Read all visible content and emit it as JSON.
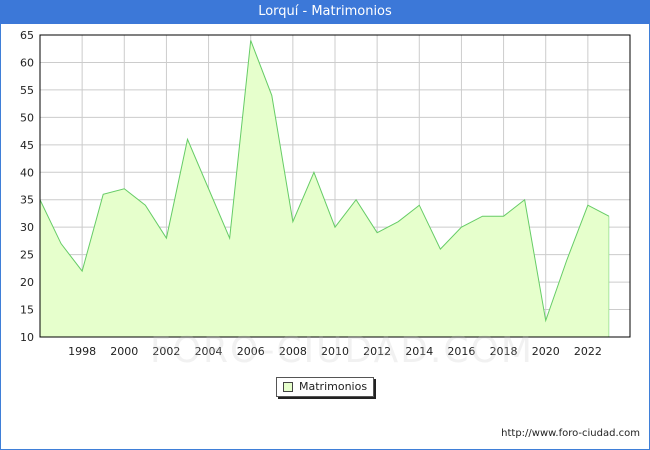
{
  "page": {
    "title": "Lorquí - Matrimonios",
    "source": "http://www.foro-ciudad.com",
    "watermark": "FORO-CIUDAD.COM"
  },
  "colors": {
    "titlebar": "#3c78d8",
    "area_fill": "#e6ffcc",
    "line": "#66cc66",
    "grid": "#cccccc"
  },
  "chart_data": {
    "type": "area",
    "title": "Lorquí - Matrimonios",
    "xlabel": "",
    "ylabel": "",
    "xlim": [
      1996,
      2024
    ],
    "ylim": [
      10,
      65
    ],
    "x_ticks": [
      1998,
      2000,
      2002,
      2004,
      2006,
      2008,
      2010,
      2012,
      2014,
      2016,
      2018,
      2020,
      2022
    ],
    "y_ticks": [
      10,
      15,
      20,
      25,
      30,
      35,
      40,
      45,
      50,
      55,
      60,
      65
    ],
    "grid": true,
    "legend_position": "bottom-center",
    "series": [
      {
        "name": "Matrimonios",
        "x": [
          1996,
          1997,
          1998,
          1999,
          2000,
          2001,
          2002,
          2003,
          2004,
          2005,
          2006,
          2007,
          2008,
          2009,
          2010,
          2011,
          2012,
          2013,
          2014,
          2015,
          2016,
          2017,
          2018,
          2019,
          2020,
          2021,
          2022,
          2023
        ],
        "values": [
          35,
          27,
          22,
          36,
          37,
          34,
          28,
          46,
          37,
          28,
          64,
          54,
          31,
          40,
          30,
          35,
          29,
          31,
          34,
          26,
          30,
          32,
          32,
          35,
          13,
          24,
          34,
          32
        ]
      }
    ]
  }
}
